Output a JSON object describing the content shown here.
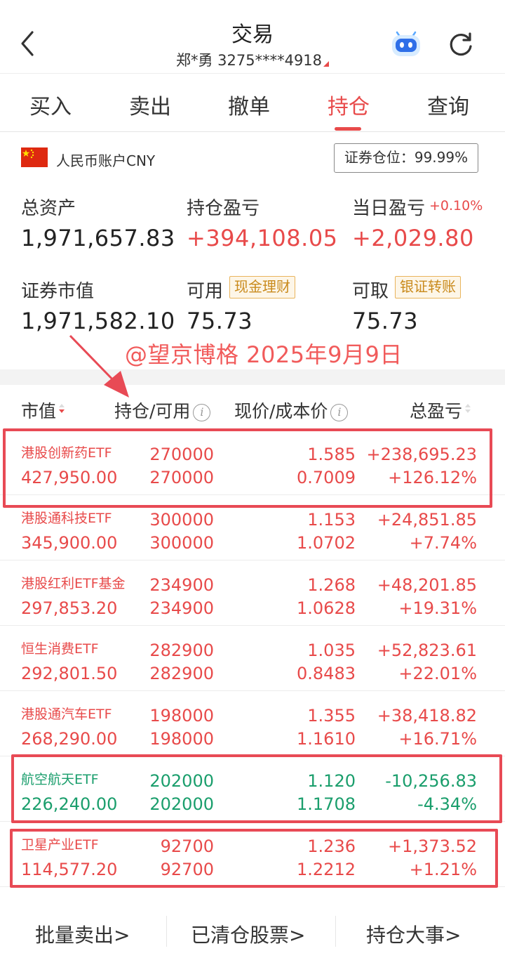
{
  "header": {
    "title": "交易",
    "account": "郑*勇 3275****4918"
  },
  "tabs": [
    {
      "label": "买入"
    },
    {
      "label": "卖出"
    },
    {
      "label": "撤单"
    },
    {
      "label": "持仓",
      "active": true
    },
    {
      "label": "查询"
    }
  ],
  "account": {
    "currency_label": "人民币账户CNY",
    "position_ratio": "证券仓位：99.99%",
    "total_assets_label": "总资产",
    "total_assets": "1,971,657.83",
    "position_pl_label": "持仓盈亏",
    "position_pl": "+394,108.05",
    "daily_pl_label": "当日盈亏",
    "daily_pl_pct": "+0.10%",
    "daily_pl": "+2,029.80",
    "market_value_label": "证券市值",
    "market_value": "1,971,582.10",
    "available_label": "可用",
    "available_tag": "现金理财",
    "available": "75.73",
    "withdrawable_label": "可取",
    "withdrawable_tag": "银证转账",
    "withdrawable": "75.73"
  },
  "watermark": "@望京博格 2025年9月9日",
  "table": {
    "col_market_value": "市值",
    "col_holding": "持仓/可用",
    "col_price": "现价/成本价",
    "col_pl": "总盈亏",
    "rows": [
      {
        "name": "港股创新药ETF",
        "market_value": "427,950.00",
        "holding": "270000",
        "available": "270000",
        "price": "1.585",
        "cost": "0.7009",
        "pl": "+238,695.23",
        "pl_pct": "+126.12%",
        "status": "up"
      },
      {
        "name": "港股通科技ETF",
        "market_value": "345,900.00",
        "holding": "300000",
        "available": "300000",
        "price": "1.153",
        "cost": "1.0702",
        "pl": "+24,851.85",
        "pl_pct": "+7.74%",
        "status": "up"
      },
      {
        "name": "港股红利ETF基金",
        "market_value": "297,853.20",
        "holding": "234900",
        "available": "234900",
        "price": "1.268",
        "cost": "1.0628",
        "pl": "+48,201.85",
        "pl_pct": "+19.31%",
        "status": "up"
      },
      {
        "name": "恒生消费ETF",
        "market_value": "292,801.50",
        "holding": "282900",
        "available": "282900",
        "price": "1.035",
        "cost": "0.8483",
        "pl": "+52,823.61",
        "pl_pct": "+22.01%",
        "status": "up"
      },
      {
        "name": "港股通汽车ETF",
        "market_value": "268,290.00",
        "holding": "198000",
        "available": "198000",
        "price": "1.355",
        "cost": "1.1610",
        "pl": "+38,418.82",
        "pl_pct": "+16.71%",
        "status": "up"
      },
      {
        "name": "航空航天ETF",
        "market_value": "226,240.00",
        "holding": "202000",
        "available": "202000",
        "price": "1.120",
        "cost": "1.1708",
        "pl": "-10,256.83",
        "pl_pct": "-4.34%",
        "status": "down"
      },
      {
        "name": "卫星产业ETF",
        "market_value": "114,577.20",
        "holding": "92700",
        "available": "92700",
        "price": "1.236",
        "cost": "1.2212",
        "pl": "+1,373.52",
        "pl_pct": "+1.21%",
        "status": "up"
      }
    ]
  },
  "bottom": {
    "batch_sell": "批量卖出>",
    "cleared": "已清仓股票>",
    "events": "持仓大事>"
  },
  "colors": {
    "up": "#e84a4a",
    "down": "#1a9e6c",
    "highlight": "#e84a55",
    "accent": "#e84a4a"
  }
}
